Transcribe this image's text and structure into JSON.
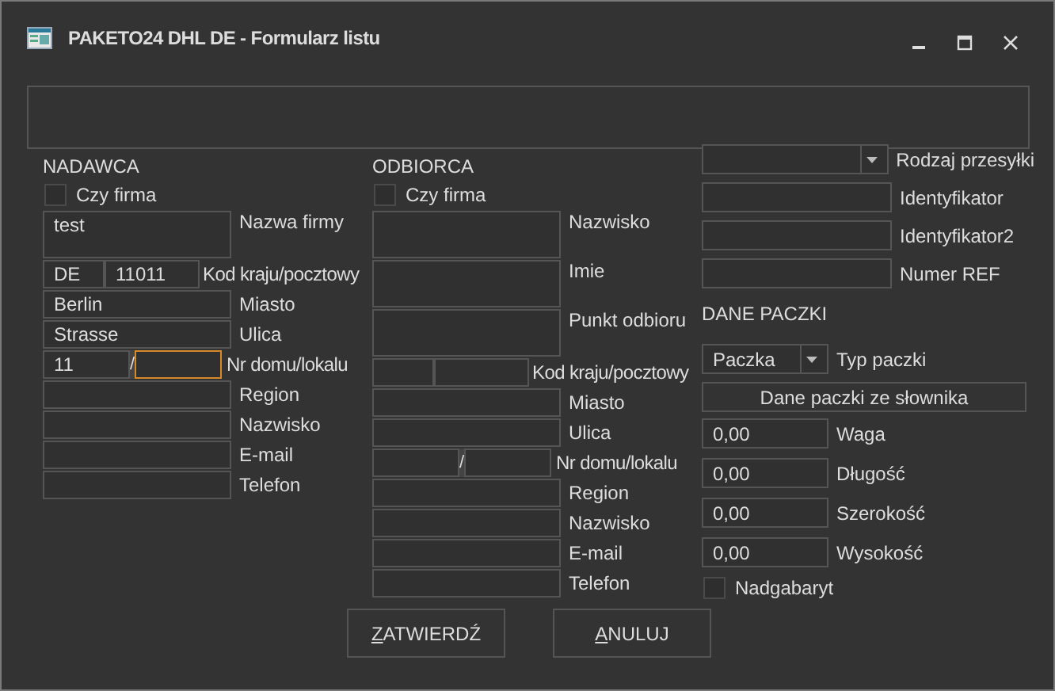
{
  "window": {
    "title": "PAKETO24 DHL DE - Formularz listu"
  },
  "sender": {
    "title": "NADAWCA",
    "company": {
      "label": "Czy firma",
      "checked": false
    },
    "rows": [
      {
        "kind": "tall",
        "label": "Nazwa firmy",
        "value": "test"
      },
      {
        "kind": "pair",
        "label": "Kod kraju/pocztowy",
        "value": "DE",
        "value2": "11011"
      },
      {
        "kind": "single",
        "label": "Miasto",
        "value": "Berlin"
      },
      {
        "kind": "single",
        "label": "Ulica",
        "value": "Strasse"
      },
      {
        "kind": "house",
        "label": "Nr domu/lokalu",
        "value": "11",
        "separator": "/",
        "second_focused": true
      },
      {
        "kind": "single",
        "label": "Region"
      },
      {
        "kind": "single",
        "label": "Nazwisko"
      },
      {
        "kind": "single",
        "label": "E-mail"
      },
      {
        "kind": "single",
        "label": "Telefon"
      }
    ]
  },
  "recipient": {
    "title": "ODBIORCA",
    "company": {
      "label": "Czy firma",
      "checked": false
    },
    "rows": [
      {
        "kind": "tall",
        "label": "Nazwisko"
      },
      {
        "kind": "tall",
        "label": "Imie"
      },
      {
        "kind": "tall",
        "label": "Punkt odbioru"
      },
      {
        "kind": "pair",
        "label": "Kod kraju/pocztowy"
      },
      {
        "kind": "single",
        "label": "Miasto"
      },
      {
        "kind": "single",
        "label": "Ulica"
      },
      {
        "kind": "house",
        "label": "Nr domu/lokalu",
        "separator": "/",
        "second_focused": false
      },
      {
        "kind": "single",
        "label": "Region"
      },
      {
        "kind": "single",
        "label": "Nazwisko"
      },
      {
        "kind": "single",
        "label": "E-mail"
      },
      {
        "kind": "single",
        "label": "Telefon"
      }
    ]
  },
  "shipment": {
    "rows": [
      {
        "kind": "combo",
        "label": "Rodzaj przesyłki"
      },
      {
        "kind": "text",
        "label": "Identyfikator"
      },
      {
        "kind": "text",
        "label": "Identyfikator2"
      },
      {
        "kind": "text",
        "label": "Numer REF"
      }
    ]
  },
  "parcel": {
    "title": "DANE PACZKI",
    "rows": [
      {
        "kind": "combo",
        "label": "Typ paczki",
        "value": "Paczka"
      },
      {
        "kind": "button",
        "text": "Dane paczki ze słownika"
      },
      {
        "kind": "number",
        "label": "Waga",
        "value": "0,00"
      },
      {
        "kind": "number",
        "label": "Długość",
        "value": "0,00"
      },
      {
        "kind": "number",
        "label": "Szerokość",
        "value": "0,00"
      },
      {
        "kind": "number",
        "label": "Wysokość",
        "value": "0,00"
      },
      {
        "kind": "checkbox",
        "text": "Nadgabaryt",
        "checked": false
      }
    ]
  },
  "buttons": [
    {
      "label": "ZATWIERDŹ"
    },
    {
      "label": "ANULUJ"
    }
  ]
}
